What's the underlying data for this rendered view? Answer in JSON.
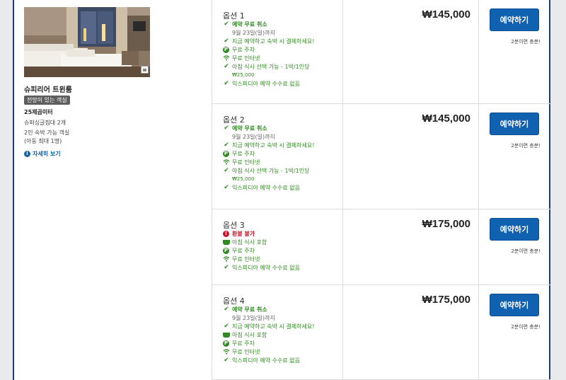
{
  "room": {
    "name": "슈피리어 트윈룸",
    "badge": "전망이 있는 객실",
    "size": "25제곱미터",
    "beds": "슈퍼싱글침대 2개",
    "occupancy_line1": "2인 숙박 가능 객실",
    "occupancy_line2": "(아동 최대 1명)",
    "details_link": "자세히 보기"
  },
  "book_label": "예약하기",
  "book_note": "2분이면 충분!",
  "colors": {
    "accent": "#1061b0",
    "feature_green": "#2e8b1e",
    "warning_red": "#c9152a",
    "frame_border": "#1f3a72"
  },
  "options": [
    {
      "title": "옵션 1",
      "price": "₩145,000",
      "features": [
        {
          "icon": "check-icon",
          "text": "예약 무료 취소",
          "style": "bold"
        },
        {
          "icon": "",
          "text": "9월 23일(일)까지",
          "style": "sub"
        },
        {
          "icon": "check-icon",
          "text": "지금 예약하고 숙박 시 결제하세요!",
          "style": ""
        },
        {
          "icon": "parking-icon",
          "text": "무료 주차",
          "style": ""
        },
        {
          "icon": "wifi-icon",
          "text": "무료 인터넷",
          "style": ""
        },
        {
          "icon": "check-icon",
          "text": "아침 식사 선택 가능 - 1박/1인당",
          "style": ""
        },
        {
          "icon": "",
          "text": "₩25,000",
          "style": "subgreen"
        },
        {
          "icon": "check-icon",
          "text": "익스피디아 예약 수수료 없음",
          "style": ""
        }
      ]
    },
    {
      "title": "옵션 2",
      "price": "₩145,000",
      "features": [
        {
          "icon": "check-icon",
          "text": "예약 무료 취소",
          "style": "bold"
        },
        {
          "icon": "",
          "text": "9월 23일(일)까지",
          "style": "sub"
        },
        {
          "icon": "check-icon",
          "text": "지금 예약하고 숙박 시 결제하세요!",
          "style": ""
        },
        {
          "icon": "parking-icon",
          "text": "무료 주차",
          "style": ""
        },
        {
          "icon": "wifi-icon",
          "text": "무료 인터넷",
          "style": ""
        },
        {
          "icon": "check-icon",
          "text": "아침 식사 선택 가능 - 1박/1인당",
          "style": ""
        },
        {
          "icon": "",
          "text": "₩25,000",
          "style": "subgreen"
        },
        {
          "icon": "check-icon",
          "text": "익스피디아 예약 수수료 없음",
          "style": ""
        }
      ]
    },
    {
      "title": "옵션 3",
      "price": "₩175,000",
      "features": [
        {
          "icon": "alert-icon",
          "text": "환불 불가",
          "style": "red"
        },
        {
          "icon": "breakfast-icon",
          "text": "아침 식사 포함",
          "style": ""
        },
        {
          "icon": "parking-icon",
          "text": "무료 주차",
          "style": ""
        },
        {
          "icon": "wifi-icon",
          "text": "무료 인터넷",
          "style": ""
        },
        {
          "icon": "check-icon",
          "text": "익스피디아 예약 수수료 없음",
          "style": ""
        }
      ]
    },
    {
      "title": "옵션 4",
      "price": "₩175,000",
      "features": [
        {
          "icon": "check-icon",
          "text": "예약 무료 취소",
          "style": "bold"
        },
        {
          "icon": "",
          "text": "9월 23일(일)까지",
          "style": "sub"
        },
        {
          "icon": "check-icon",
          "text": "지금 예약하고 숙박 시 결제하세요!",
          "style": ""
        },
        {
          "icon": "breakfast-icon",
          "text": "아침 식사 포함",
          "style": ""
        },
        {
          "icon": "parking-icon",
          "text": "무료 주차",
          "style": ""
        },
        {
          "icon": "wifi-icon",
          "text": "무료 인터넷",
          "style": ""
        },
        {
          "icon": "check-icon",
          "text": "익스피디아 예약 수수료 없음",
          "style": ""
        }
      ]
    }
  ]
}
